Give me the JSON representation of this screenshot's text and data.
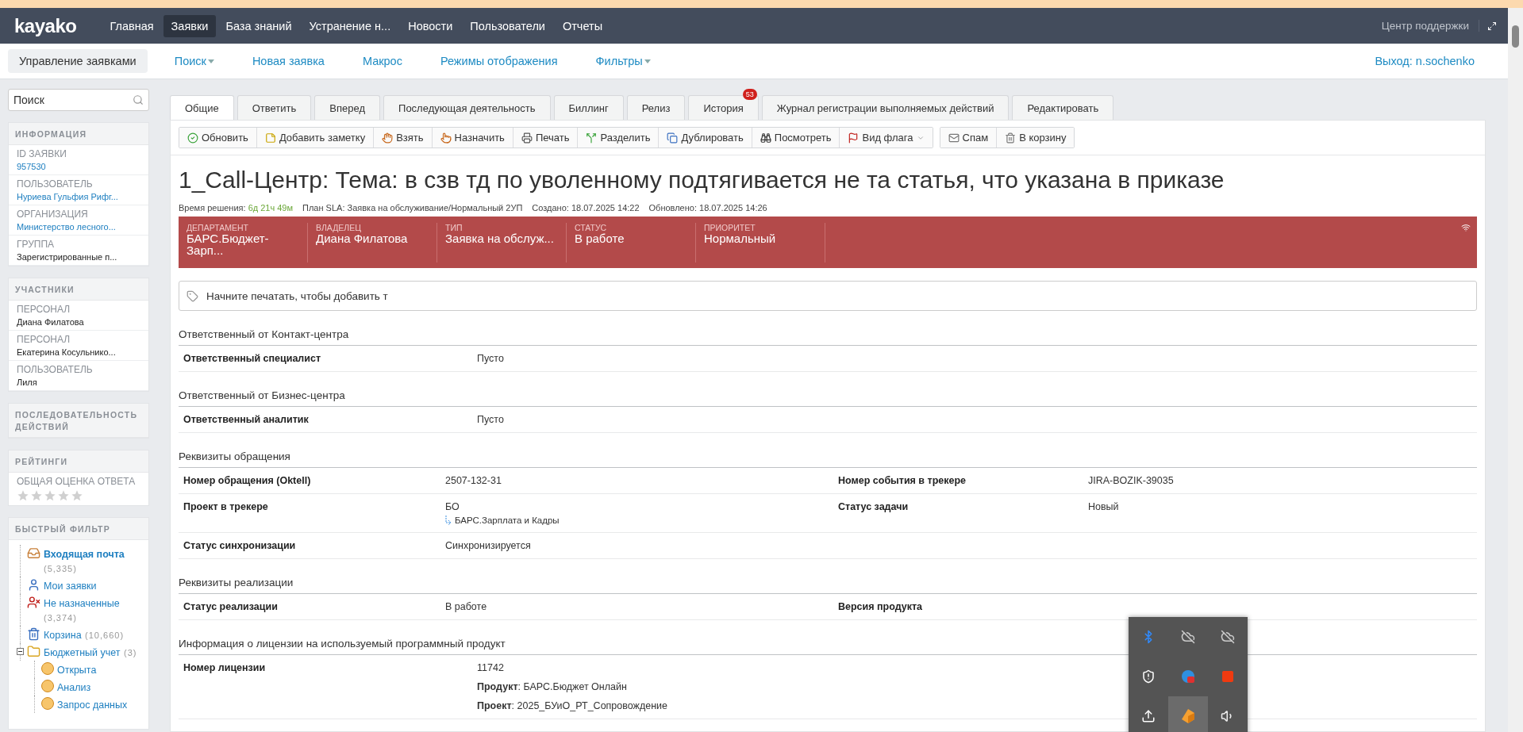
{
  "nav": {
    "logo": "kayako",
    "items": [
      {
        "label": "Главная",
        "selected": false
      },
      {
        "label": "Заявки",
        "selected": true
      },
      {
        "label": "База знаний",
        "selected": false
      },
      {
        "label": "Устранение н...",
        "selected": false
      },
      {
        "label": "Новости",
        "selected": false
      },
      {
        "label": "Пользователи",
        "selected": false
      },
      {
        "label": "Отчеты",
        "selected": false
      }
    ],
    "support": "Центр поддержки"
  },
  "subnav": {
    "items": [
      {
        "label": "Управление заявками",
        "selected": true,
        "dropdown": false
      },
      {
        "label": "Поиск",
        "selected": false,
        "dropdown": true
      },
      {
        "label": "Новая заявка",
        "selected": false,
        "dropdown": false
      },
      {
        "label": "Макрос",
        "selected": false,
        "dropdown": false
      },
      {
        "label": "Режимы отображения",
        "selected": false,
        "dropdown": false
      },
      {
        "label": "Фильтры",
        "selected": false,
        "dropdown": true
      }
    ],
    "logout": "Выход: n.sochenko"
  },
  "sidebar": {
    "search": {
      "placeholder": "Поиск"
    },
    "info": {
      "title": "ИНФОРМАЦИЯ",
      "items": [
        {
          "label": "ID ЗАЯВКИ",
          "value": "957530",
          "link": true
        },
        {
          "label": "ПОЛЬЗОВАТЕЛЬ",
          "value": "Нуриева Гульфия Рифг...",
          "link": true
        },
        {
          "label": "ОРГАНИЗАЦИЯ",
          "value": "Министерство лесного...",
          "link": true
        },
        {
          "label": "ГРУППА",
          "value": "Зарегистрированные п...",
          "link": false
        }
      ]
    },
    "participants": {
      "title": "УЧАСТНИКИ",
      "items": [
        {
          "label": "ПЕРСОНАЛ",
          "value": "Диана Филатова",
          "link": false
        },
        {
          "label": "ПЕРСОНАЛ",
          "value": "Екатерина Косульнико...",
          "link": false
        },
        {
          "label": "ПОЛЬЗОВАТЕЛЬ",
          "value": "Лиля",
          "link": false
        }
      ]
    },
    "sequence": {
      "title": "ПОСЛЕДОВАТЕЛЬНОСТЬ ДЕЙСТВИЙ"
    },
    "ratings": {
      "title": "РЕЙТИНГИ",
      "label": "ОБЩАЯ ОЦЕНКА ОТВЕТА",
      "stars": 0
    },
    "filter": {
      "title": "БЫСТРЫЙ ФИЛЬТР",
      "items": [
        {
          "kind": "inbox",
          "label": "Входящая почта",
          "count": "(5,335)",
          "selected": true
        },
        {
          "kind": "user",
          "label": "Мои заявки",
          "selected": false
        },
        {
          "kind": "unassigned",
          "label": "Не назначенные",
          "count": "(3,374)",
          "selected": false
        },
        {
          "kind": "trash",
          "label": "Корзина",
          "count": "(10,660)",
          "selected": false
        },
        {
          "kind": "folder",
          "label": "Бюджетный учет",
          "count": "(3)",
          "selected": false,
          "expanded": true,
          "children": [
            {
              "kind": "status",
              "label": "Открыта",
              "selected": false
            },
            {
              "kind": "status",
              "label": "Анализ",
              "selected": false
            },
            {
              "kind": "status",
              "label": "Запрос данных",
              "selected": false
            }
          ]
        }
      ]
    }
  },
  "tabs": [
    {
      "label": "Общие",
      "selected": true
    },
    {
      "label": "Ответить",
      "selected": false
    },
    {
      "label": "Вперед",
      "selected": false
    },
    {
      "label": "Последующая деятельность",
      "selected": false
    },
    {
      "label": "Биллинг",
      "selected": false
    },
    {
      "label": "Релиз",
      "selected": false
    },
    {
      "label": "История",
      "selected": false,
      "badge": "53"
    },
    {
      "label": "Журнал регистрации выполняемых действий",
      "selected": false
    },
    {
      "label": "Редактировать",
      "selected": false
    }
  ],
  "toolbar": [
    {
      "buttons": [
        {
          "kind": "refresh",
          "label": "Обновить"
        },
        {
          "kind": "note",
          "label": "Добавить заметку"
        },
        {
          "kind": "take",
          "label": "Взять"
        },
        {
          "kind": "assign",
          "label": "Назначить"
        },
        {
          "kind": "print",
          "label": "Печать"
        },
        {
          "kind": "split",
          "label": "Разделить"
        },
        {
          "kind": "duplicate",
          "label": "Дублировать"
        },
        {
          "kind": "view",
          "label": "Посмотреть"
        },
        {
          "kind": "flag",
          "label": "Вид флага",
          "dropdown": true
        }
      ]
    },
    {
      "buttons": [
        {
          "kind": "spam",
          "label": "Спам"
        },
        {
          "kind": "trash",
          "label": "В корзину"
        }
      ]
    }
  ],
  "ticket": {
    "title": "1_Call-Центр: Тема: в сзв тд по уволенному подтягивается не та статья, что указана в приказе",
    "resolution": {
      "label": "Время решения:",
      "value": "6д 21ч 49м"
    },
    "meta": [
      "План SLA: Заявка на обслуживание/Нормальный 2УП",
      "Создано: 18.07.2025 14:22",
      "Обновлено: 18.07.2025 14:26"
    ],
    "properties": [
      {
        "label": "ДЕПАРТАМЕНТ",
        "value": "БАРС.Бюджет-Зарп..."
      },
      {
        "label": "ВЛАДЕЛЕЦ",
        "value": "Диана Филатова"
      },
      {
        "label": "ТИП",
        "value": "Заявка на обслуж..."
      },
      {
        "label": "СТАТУС",
        "value": "В работе"
      },
      {
        "label": "ПРИОРИТЕТ",
        "value": "Нормальный"
      }
    ],
    "tags": {
      "placeholder": "Начните печатать, чтобы добавить т"
    }
  },
  "sections": [
    {
      "title": "Ответственный от Контакт-центра",
      "kind": "single",
      "rows": [
        {
          "label": "Ответственный специалист",
          "values": [
            "Пусто"
          ]
        }
      ]
    },
    {
      "title": "Ответственный от Бизнес-центра",
      "kind": "single",
      "rows": [
        {
          "label": "Ответственный аналитик",
          "values": [
            "Пусто"
          ]
        }
      ]
    },
    {
      "title": "Реквизиты обращения",
      "kind": "double",
      "rows": [
        {
          "label": "Номер обращения (Oktell)",
          "values": [
            "2507-132-31"
          ],
          "label2": "Номер события в трекере",
          "value2": "JIRA-BOZIK-39035"
        },
        {
          "label": "Проект в трекере",
          "values": [
            "БО"
          ],
          "sub": "БАРС.Зарплата и Кадры",
          "label2": "Статус задачи",
          "value2": "Новый"
        },
        {
          "label": "Статус синхронизации",
          "values": [
            "Синхронизируется"
          ]
        }
      ]
    },
    {
      "title": "Реквизиты реализации",
      "kind": "double",
      "rows": [
        {
          "label": "Статус реализации",
          "values": [
            "В работе"
          ],
          "label2": "Версия продукта"
        }
      ]
    },
    {
      "title": "Информация о лицензии на используемый программный продукт",
      "kind": "single",
      "rows": [
        {
          "label": "Номер лицензии",
          "values": [
            "11742",
            "**Продукт**: БАРС.Бюджет Онлайн",
            "**Проект**: 2025_БУиО_РТ_Сопровождение"
          ]
        }
      ]
    }
  ]
}
